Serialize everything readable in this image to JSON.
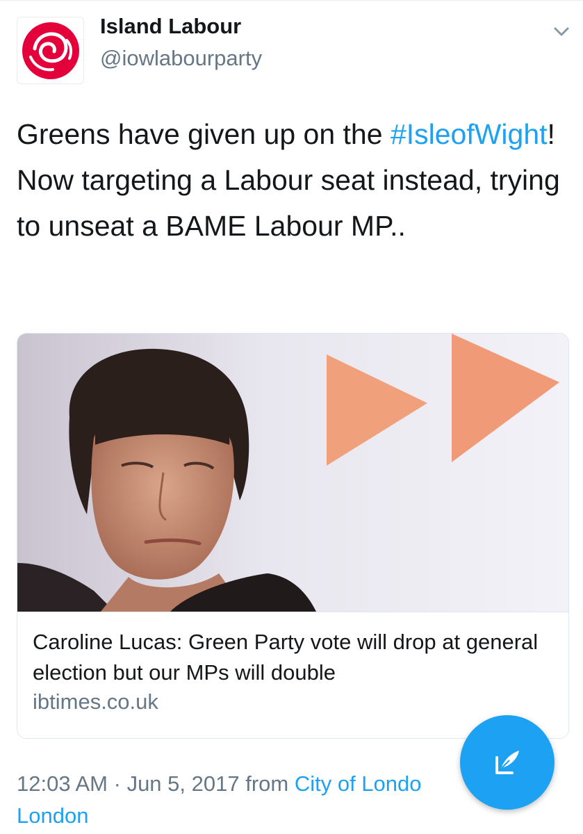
{
  "account": {
    "display_name": "Island Labour",
    "handle": "@iowlabourparty",
    "avatar_icon": "labour-rose-logo",
    "menu_icon": "chevron-down-icon"
  },
  "tweet": {
    "text_before": "Greens have given up on the ",
    "hashtag": "#IsleofWight",
    "text_after": "! Now targeting a Labour seat instead, trying to unseat a BAME Labour MP.."
  },
  "card": {
    "title": "Caroline Lucas: Green Party vote will drop at general election but our MPs will double",
    "domain": "ibtimes.co.uk"
  },
  "meta": {
    "time": "12:03 AM",
    "separator": "·",
    "date": "Jun 5, 2017",
    "from_label": "from",
    "location_part1": "City of Londo",
    "location_part2": "London"
  },
  "fab": {
    "icon": "compose-tweet-icon"
  },
  "colors": {
    "link": "#1da1f2",
    "text": "#14171a",
    "secondary": "#657786",
    "brand_red": "#e4003b"
  }
}
